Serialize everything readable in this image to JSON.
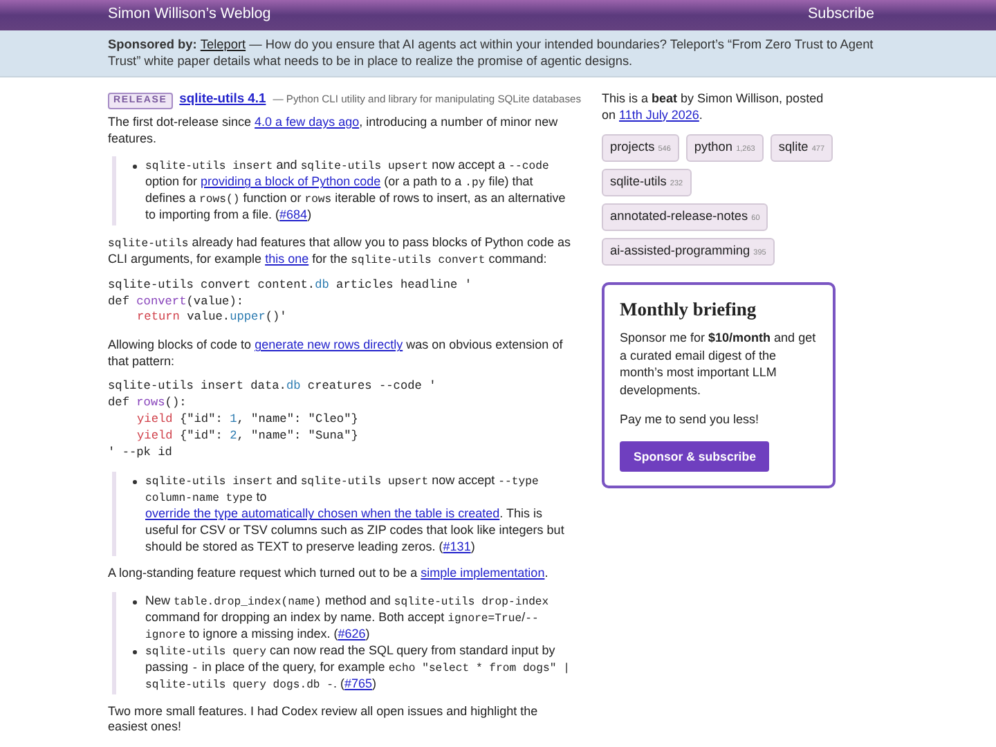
{
  "header": {
    "title": "Simon Willison’s Weblog",
    "subscribe": "Subscribe"
  },
  "sponsor": [
    {
      "kind": "bold",
      "text": "Sponsored by: "
    },
    {
      "kind": "link",
      "text": "Teleport"
    },
    {
      "kind": "text",
      "text": " — How do you ensure that AI agents act within your intended boundaries? Teleport’s “From Zero Trust to Agent Trust” white paper details what needs to be in place to realize the promise of agentic designs."
    }
  ],
  "release": {
    "badge": "RELEASE",
    "title": "sqlite-utils 4.1",
    "description": "— Python CLI utility and library for manipulating SQLite databases"
  },
  "blocks": [
    {
      "kind": "para",
      "segments": [
        {
          "kind": "text",
          "text": "The first dot-release since "
        },
        {
          "kind": "link",
          "text": "4.0 a few days ago"
        },
        {
          "kind": "text",
          "text": ", introducing a number of minor new features."
        }
      ]
    },
    {
      "kind": "quote",
      "items": [
        [
          {
            "kind": "code",
            "text": "sqlite-utils insert"
          },
          {
            "kind": "text",
            "text": " and "
          },
          {
            "kind": "code",
            "text": "sqlite-utils upsert"
          },
          {
            "kind": "text",
            "text": " now accept a "
          },
          {
            "kind": "code",
            "text": "--code"
          },
          {
            "kind": "text",
            "text": " option for "
          },
          {
            "kind": "link",
            "text": "providing a block of Python code"
          },
          {
            "kind": "text",
            "text": " (or a path to a "
          },
          {
            "kind": "code",
            "text": ".py"
          },
          {
            "kind": "text",
            "text": " file) that defines a "
          },
          {
            "kind": "code",
            "text": "rows()"
          },
          {
            "kind": "text",
            "text": " function or "
          },
          {
            "kind": "code",
            "text": "rows"
          },
          {
            "kind": "text",
            "text": " iterable of rows to insert, as an alternative to importing from a file. ("
          },
          {
            "kind": "link",
            "text": "#684"
          },
          {
            "kind": "text",
            "text": ")"
          }
        ]
      ]
    },
    {
      "kind": "para",
      "segments": [
        {
          "kind": "code",
          "text": "sqlite-utils"
        },
        {
          "kind": "text",
          "text": " already had features that allow you to pass blocks of Python code as CLI arguments, for example "
        },
        {
          "kind": "link",
          "text": "this one"
        },
        {
          "kind": "text",
          "text": " for the "
        },
        {
          "kind": "code",
          "text": "sqlite-utils convert"
        },
        {
          "kind": "text",
          "text": " command:"
        }
      ]
    },
    {
      "kind": "code",
      "lines": [
        [
          {
            "kind": "plain",
            "text": "sqlite-utils convert content."
          },
          {
            "kind": "attr",
            "text": "db"
          },
          {
            "kind": "plain",
            "text": " articles headline '"
          }
        ],
        [
          {
            "kind": "plain",
            "text": "def "
          },
          {
            "kind": "func",
            "text": "convert"
          },
          {
            "kind": "plain",
            "text": "(value):"
          }
        ],
        {
          "indent": true,
          "tokens": [
            {
              "kind": "keyword",
              "text": "return"
            },
            {
              "kind": "plain",
              "text": " value."
            },
            {
              "kind": "attr",
              "text": "upper"
            },
            {
              "kind": "plain",
              "text": "()'"
            }
          ]
        }
      ]
    },
    {
      "kind": "para",
      "segments": [
        {
          "kind": "text",
          "text": "Allowing blocks of code to "
        },
        {
          "kind": "link",
          "text": "generate new rows directly"
        },
        {
          "kind": "text",
          "text": " was on obvious extension of that pattern:"
        }
      ]
    },
    {
      "kind": "code",
      "lines": [
        [
          {
            "kind": "plain",
            "text": "sqlite-utils insert data."
          },
          {
            "kind": "attr",
            "text": "db"
          },
          {
            "kind": "plain",
            "text": " creatures --code '"
          }
        ],
        [
          {
            "kind": "plain",
            "text": "def "
          },
          {
            "kind": "func",
            "text": "rows"
          },
          {
            "kind": "plain",
            "text": "():"
          }
        ],
        {
          "indent": true,
          "tokens": [
            {
              "kind": "keyword",
              "text": "yield"
            },
            {
              "kind": "plain",
              "text": " {\"id\": "
            },
            {
              "kind": "number",
              "text": "1"
            },
            {
              "kind": "plain",
              "text": ", \"name\": \"Cleo\"}"
            }
          ]
        },
        {
          "indent": true,
          "tokens": [
            {
              "kind": "keyword",
              "text": "yield"
            },
            {
              "kind": "plain",
              "text": " {\"id\": "
            },
            {
              "kind": "number",
              "text": "2"
            },
            {
              "kind": "plain",
              "text": ", \"name\": \"Suna\"}"
            }
          ]
        },
        [
          {
            "kind": "plain",
            "text": "' --pk id"
          }
        ]
      ]
    },
    {
      "kind": "quote",
      "items": [
        [
          {
            "kind": "code",
            "text": "sqlite-utils insert"
          },
          {
            "kind": "text",
            "text": " and "
          },
          {
            "kind": "code",
            "text": "sqlite-utils upsert"
          },
          {
            "kind": "text",
            "text": " now accept "
          },
          {
            "kind": "code",
            "text": "--type column-name type"
          },
          {
            "kind": "text",
            "text": " to "
          },
          {
            "kind": "link",
            "text": "override the type automatically chosen when the table is created"
          },
          {
            "kind": "text",
            "text": ". This is useful for CSV or TSV columns such as ZIP codes that look like integers but should be stored as TEXT to preserve leading zeros. ("
          },
          {
            "kind": "link",
            "text": "#131"
          },
          {
            "kind": "text",
            "text": ")"
          }
        ]
      ]
    },
    {
      "kind": "para",
      "segments": [
        {
          "kind": "text",
          "text": "A long-standing feature request which turned out to be a "
        },
        {
          "kind": "link",
          "text": "simple implementation"
        },
        {
          "kind": "text",
          "text": "."
        }
      ]
    },
    {
      "kind": "quote",
      "items": [
        [
          {
            "kind": "text",
            "text": "New "
          },
          {
            "kind": "code",
            "text": "table.drop_index(name)"
          },
          {
            "kind": "text",
            "text": " method and "
          },
          {
            "kind": "code",
            "text": "sqlite-utils drop-index"
          },
          {
            "kind": "text",
            "text": " command for dropping an index by name. Both accept "
          },
          {
            "kind": "code",
            "text": "ignore=True"
          },
          {
            "kind": "text",
            "text": "/"
          },
          {
            "kind": "code",
            "text": "--ignore"
          },
          {
            "kind": "text",
            "text": " to ignore a missing index. ("
          },
          {
            "kind": "link",
            "text": "#626"
          },
          {
            "kind": "text",
            "text": ")"
          }
        ],
        [
          {
            "kind": "code",
            "text": "sqlite-utils query"
          },
          {
            "kind": "text",
            "text": " can now read the SQL query from standard input by passing "
          },
          {
            "kind": "code",
            "text": "-"
          },
          {
            "kind": "text",
            "text": " in place of the query, for example "
          },
          {
            "kind": "code",
            "text": "echo \"select * from dogs\" | sqlite-utils query dogs.db -"
          },
          {
            "kind": "text",
            "text": ". ("
          },
          {
            "kind": "link",
            "text": "#765"
          },
          {
            "kind": "text",
            "text": ")"
          }
        ]
      ]
    },
    {
      "kind": "para",
      "segments": [
        {
          "kind": "text",
          "text": "Two more small features. I had Codex review all open issues and highlight the easiest ones!"
        }
      ]
    }
  ],
  "sidebar": {
    "intro": [
      {
        "kind": "text",
        "text": "This is a "
      },
      {
        "kind": "bold",
        "text": "beat"
      },
      {
        "kind": "text",
        "text": " by Simon Willison, posted on "
      },
      {
        "kind": "link",
        "text": "11th July 2026"
      },
      {
        "kind": "text",
        "text": "."
      }
    ],
    "tags": [
      {
        "name": "projects",
        "count": "546"
      },
      {
        "name": "python",
        "count": "1,263"
      },
      {
        "name": "sqlite",
        "count": "477"
      },
      {
        "name": "sqlite-utils",
        "count": "232"
      },
      {
        "name": "annotated-release-notes",
        "count": "60"
      },
      {
        "name": "ai-assisted-programming",
        "count": "395"
      }
    ],
    "briefing": {
      "title": "Monthly briefing",
      "paragraphs": [
        [
          {
            "kind": "text",
            "text": "Sponsor me for "
          },
          {
            "kind": "bold",
            "text": "$10/month"
          },
          {
            "kind": "text",
            "text": " and get a curated email digest of the month’s most important LLM developments."
          }
        ],
        [
          {
            "kind": "text",
            "text": "Pay me to send you less!"
          }
        ]
      ],
      "button": "Sponsor & subscribe"
    }
  }
}
